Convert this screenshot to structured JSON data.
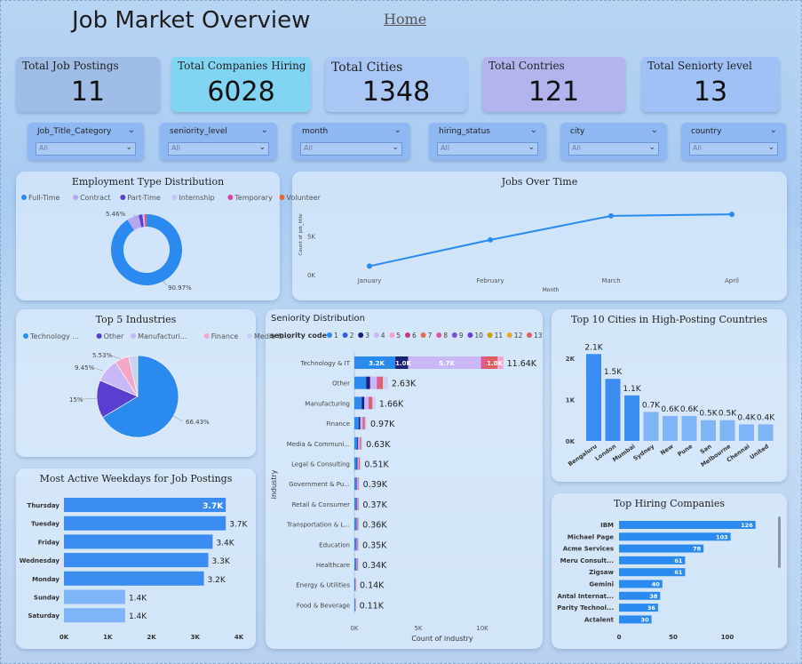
{
  "header": {
    "title": "Job Market Overview",
    "home_link": "Home"
  },
  "kpis": [
    {
      "label": "Total Job Postings",
      "value": "11",
      "color": "#9fbde6"
    },
    {
      "label": "Total Companies Hiring",
      "value": "6028",
      "color": "#82d4f3"
    },
    {
      "label": "Total Cities",
      "value": "1348",
      "color": "#a9c6f5"
    },
    {
      "label": "Total Contries",
      "value": "121",
      "color": "#b3b4ee"
    },
    {
      "label": "Total Seniorty level",
      "value": "13",
      "color": "#9fc1f6"
    }
  ],
  "slicers": [
    {
      "label": "Job_Title_Category",
      "value": "All"
    },
    {
      "label": "seniority_level",
      "value": "All"
    },
    {
      "label": "month",
      "value": "All"
    },
    {
      "label": "hiring_status",
      "value": "All"
    },
    {
      "label": "city",
      "value": "All"
    },
    {
      "label": "country",
      "value": "All"
    }
  ],
  "charts": {
    "employment": {
      "title": "Employment Type Distribution"
    },
    "jobs_time": {
      "title": "Jobs Over Time"
    },
    "industries": {
      "title": "Top 5 Industries"
    },
    "seniority": {
      "title": "Seniority Distribution",
      "legend_title": "seniority code"
    },
    "cities": {
      "title": "Top 10 Cities in High-Posting Countries"
    },
    "weekdays": {
      "title": "Most Active Weekdays for Job Postings"
    },
    "companies": {
      "title": "Top Hiring Companies"
    }
  },
  "chart_data": [
    {
      "id": "employment",
      "type": "pie",
      "title": "Employment Type Distribution",
      "labels": [
        "Full-Time",
        "Contract",
        "Part-Time",
        "Internship",
        "Temporary",
        "Volunteer"
      ],
      "colors": [
        "#2b8af0",
        "#b9a6f3",
        "#5a3ed0",
        "#c9c2f2",
        "#e0439b",
        "#e4673a"
      ],
      "values": [
        90.97,
        5.46,
        1.7,
        0.9,
        0.57,
        0.4
      ],
      "data_labels": [
        "90.97%",
        "5.46%"
      ]
    },
    {
      "id": "jobs_time",
      "type": "line",
      "title": "Jobs Over Time",
      "x": [
        "January",
        "February",
        "March",
        "April"
      ],
      "y": [
        1100,
        4500,
        7600,
        7800
      ],
      "xlabel": "Month",
      "ylabel": "Count of job_title",
      "ylim": [
        0,
        10000
      ],
      "ticks": [
        "0K",
        "5K"
      ]
    },
    {
      "id": "industries",
      "type": "pie",
      "title": "Top 5 Industries",
      "labels": [
        "Technology ...",
        "Other",
        "Manufacturi...",
        "Finance",
        "Media & ..."
      ],
      "colors": [
        "#2b8af0",
        "#5a3ed0",
        "#c9b8f6",
        "#f2a6c8",
        "#c8d2f4"
      ],
      "values": [
        66.43,
        15,
        9.45,
        5.53,
        3.59
      ],
      "data_labels": [
        "66.43%",
        "15%",
        "9.45%",
        "5.53%"
      ]
    },
    {
      "id": "seniority",
      "type": "bar",
      "title": "Seniority Distribution",
      "legend": [
        "1",
        "2",
        "3",
        "4",
        "5",
        "6",
        "7",
        "8",
        "9",
        "10",
        "11",
        "12",
        "13"
      ],
      "legend_colors": [
        "#2b8af0",
        "#2f5fd8",
        "#1a1f7a",
        "#c9b8f6",
        "#f7a0c8",
        "#c93a86",
        "#e07050",
        "#e2559a",
        "#7d4ed8",
        "#6a3fd0",
        "#c9a200",
        "#e9a92a",
        "#e06060"
      ],
      "categories": [
        "Technology & IT",
        "Other",
        "Manufacturing",
        "Finance",
        "Media & Communi...",
        "Legal & Consulting",
        "Government & Pu...",
        "Retail & Consumer",
        "Transportation & L...",
        "Education",
        "Healthcare",
        "Energy & Utilities",
        "Food & Beverage"
      ],
      "values": [
        11640,
        2630,
        1660,
        970,
        630,
        510,
        390,
        370,
        360,
        350,
        340,
        140,
        110
      ],
      "value_labels": [
        "11.64K",
        "2.63K",
        "1.66K",
        "0.97K",
        "0.63K",
        "0.51K",
        "0.39K",
        "0.37K",
        "0.36K",
        "0.35K",
        "0.34K",
        "0.14K",
        "0.11K"
      ],
      "segment_labels": [
        "3.2K",
        "1.0K",
        "5.7K",
        "1.0K"
      ],
      "xlabel": "Count of industry",
      "ylabel": "industry",
      "xticks": [
        "0K",
        "5K",
        "10K"
      ],
      "xlim": [
        0,
        12000
      ]
    },
    {
      "id": "cities",
      "type": "bar",
      "title": "Top 10 Cities in High-Posting Countries",
      "categories": [
        "Bengaluru",
        "London",
        "Mumbai",
        "Sydney",
        "New",
        "Pune",
        "San",
        "Melbourne",
        "Chennai",
        "United"
      ],
      "values": [
        2100,
        1500,
        1100,
        700,
        600,
        600,
        500,
        500,
        400,
        400
      ],
      "value_labels": [
        "2.1K",
        "1.5K",
        "1.1K",
        "0.7K",
        "0.6K",
        "0.6K",
        "0.5K",
        "0.5K",
        "0.4K",
        "0.4K"
      ],
      "yticks": [
        "0K",
        "1K",
        "2K"
      ],
      "ylim": [
        0,
        2300
      ]
    },
    {
      "id": "weekdays",
      "type": "bar",
      "title": "Most Active Weekdays for Job Postings",
      "categories": [
        "Thursday",
        "Tuesday",
        "Friday",
        "Wednesday",
        "Monday",
        "Sunday",
        "Saturday"
      ],
      "values": [
        3700,
        3700,
        3400,
        3300,
        3200,
        1400,
        1400
      ],
      "value_labels": [
        "3.7K",
        "3.7K",
        "3.4K",
        "3.3K",
        "3.2K",
        "1.4K",
        "1.4K"
      ],
      "xticks": [
        "0K",
        "1K",
        "2K",
        "3K",
        "4K"
      ],
      "xlim": [
        0,
        4000
      ]
    },
    {
      "id": "companies",
      "type": "bar",
      "title": "Top Hiring Companies",
      "categories": [
        "IBM",
        "Michael Page",
        "Acme Services",
        "Meru Consult...",
        "Zigsaw",
        "Gemini",
        "Antal Internat...",
        "Parity Technol...",
        "Actalent"
      ],
      "values": [
        126,
        103,
        78,
        61,
        61,
        40,
        38,
        36,
        30
      ],
      "xticks": [
        "0",
        "50",
        "100"
      ],
      "xlim": [
        0,
        130
      ]
    }
  ]
}
